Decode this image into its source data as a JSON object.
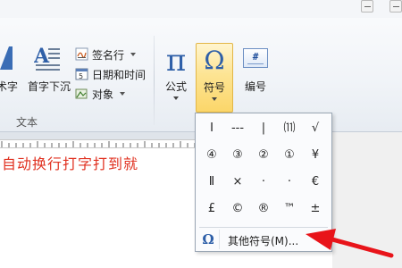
{
  "window": {
    "controls": [
      "minimize",
      "restore"
    ]
  },
  "ribbon": {
    "partial_button": {
      "label": "术字",
      "icon": "wordart-icon"
    },
    "dropcap_button": {
      "label": "首字下沉",
      "icon": "dropcap-icon"
    },
    "text_group_small": [
      {
        "label": "签名行",
        "icon": "signature-line-icon",
        "has_dropdown": true
      },
      {
        "label": "日期和时间",
        "icon": "date-time-icon",
        "has_dropdown": false
      },
      {
        "label": "对象",
        "icon": "object-icon",
        "has_dropdown": true
      }
    ],
    "text_group_label": "文本",
    "equation_button": {
      "label": "公式",
      "glyph": "π"
    },
    "symbol_button": {
      "label": "符号",
      "glyph": "Ω",
      "active": true
    },
    "numbering_button": {
      "label": "编号",
      "glyph": "#"
    }
  },
  "document": {
    "text": "自动换行打字打到就",
    "color": "#e0301f"
  },
  "symbol_menu": {
    "symbols": [
      "Ⅰ",
      "---",
      "|",
      "⑾",
      "√",
      "④",
      "③",
      "②",
      "①",
      "¥",
      "Ⅱ",
      "×",
      "·",
      "·",
      "€",
      "£",
      "©",
      "®",
      "™",
      "±"
    ],
    "more_symbols": {
      "glyph": "Ω",
      "label": "其他符号(M)..."
    }
  },
  "colors": {
    "accent_blue": "#2e5fa8",
    "active_button": "#fbd66a",
    "annotation_red": "#e8141a"
  }
}
